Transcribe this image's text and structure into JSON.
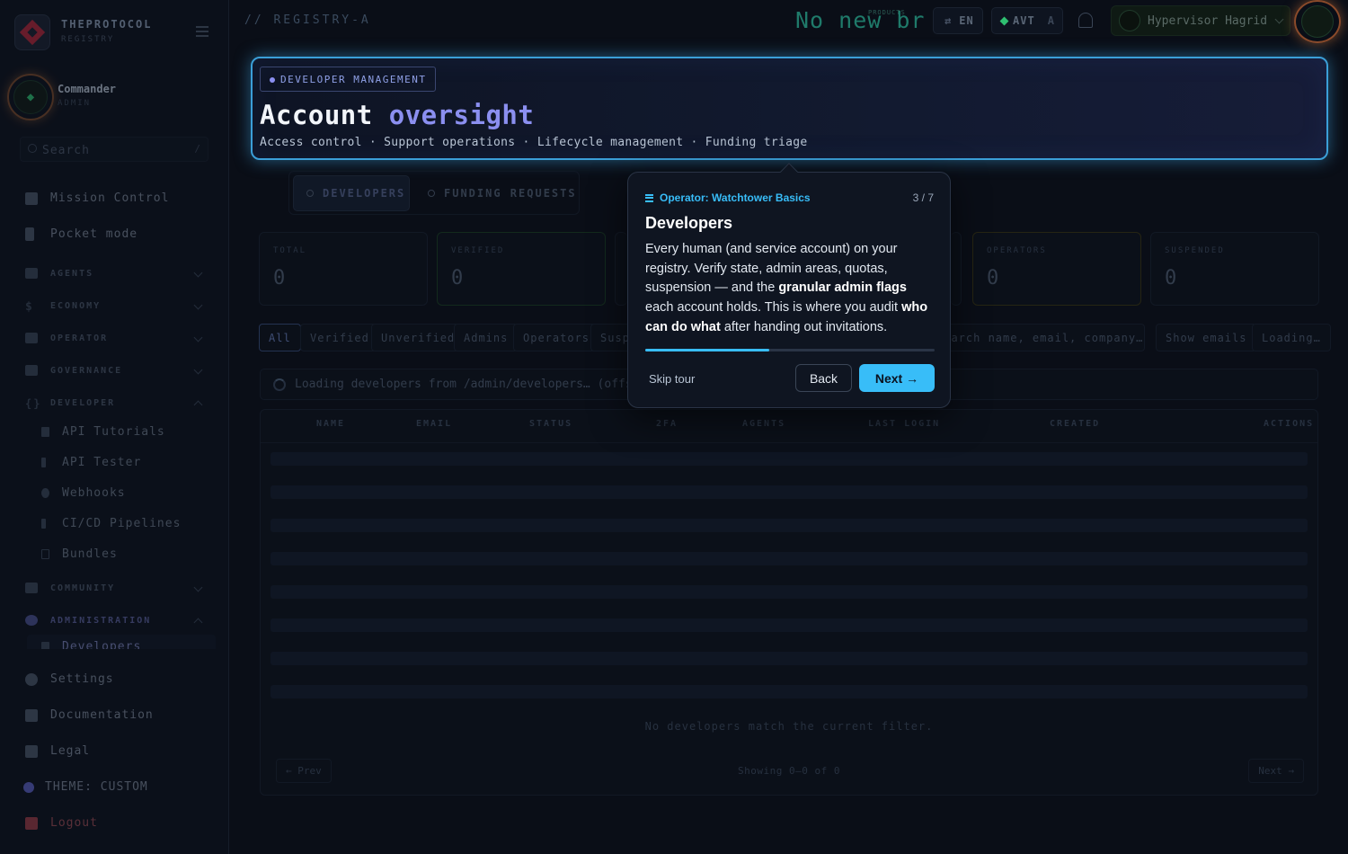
{
  "brand": {
    "name": "THEPROTOCOL",
    "sub": "REGISTRY"
  },
  "user": {
    "name": "Commander",
    "role": "ADMIN"
  },
  "search": {
    "placeholder": "Search",
    "shortcut": "/"
  },
  "sidebar": {
    "top_items": [
      "Mission Control",
      "Pocket mode"
    ],
    "sections": [
      "AGENTS",
      "ECONOMY",
      "OPERATOR",
      "GOVERNANCE",
      "DEVELOPER"
    ],
    "developer_items": [
      "API Tutorials",
      "API Tester",
      "Webhooks",
      "CI/CD Pipelines",
      "Bundles"
    ],
    "sections2": [
      "COMMUNITY",
      "ADMINISTRATION"
    ],
    "admin_item": "Developers",
    "bottom_items": [
      "Settings",
      "Documentation",
      "Legal"
    ],
    "theme": "THEME: CUSTOM",
    "logout": "Logout"
  },
  "topbar": {
    "title": "// REGISTRY-A",
    "ticker": "No new br",
    "ticker_small": "PRODUCTS",
    "lang": "EN",
    "currency": "AVT",
    "currency_suffix": "A",
    "user": "Hypervisor Hagrid"
  },
  "hero": {
    "badge": "DEVELOPER MANAGEMENT",
    "title_plain": "Account",
    "title_accent": "oversight",
    "subtitle": "Access control · Support operations · Lifecycle management · Funding triage"
  },
  "tabs": [
    "DEVELOPERS",
    "FUNDING REQUESTS"
  ],
  "stats": [
    {
      "label": "TOTAL",
      "value": "0"
    },
    {
      "label": "VERIFIED",
      "value": "0"
    },
    {
      "label": "OPERATORS",
      "value": "0"
    },
    {
      "label": "SUSPENDED",
      "value": "0"
    }
  ],
  "filters": [
    "All",
    "Verified",
    "Unverified",
    "Admins",
    "Operators",
    "Suspe"
  ],
  "table_search_placeholder": "Search name, email, company…",
  "show_emails": "Show emails",
  "loading_chip": "Loading…",
  "loading_text": "Loading developers from /admin/developers… (offset",
  "columns": [
    "NAME",
    "EMAIL",
    "STATUS",
    "2FA",
    "AGENTS",
    "LAST LOGIN",
    "CREATED",
    "ACTIONS"
  ],
  "empty": "No developers match the current filter.",
  "pagination": {
    "prev": "← Prev",
    "info": "Showing 0–0 of 0",
    "next": "Next →"
  },
  "tour": {
    "kicker": "Operator: Watchtower Basics",
    "step": "3 / 7",
    "title": "Developers",
    "body_1": "Every human (and service account) on your registry. Verify state, admin areas, quotas, suspension — and the ",
    "body_bold_1": "granular admin flags",
    "body_2": " each account holds. This is where you audit ",
    "body_bold_2": "who can do what",
    "body_3": " after handing out invitations.",
    "progress": 0.43,
    "skip": "Skip tour",
    "back": "Back",
    "next": "Next →"
  },
  "colors": {
    "accent": "#38bdf8",
    "hero_border": "#3b9fd8",
    "title_accent": "#8b8ff0"
  }
}
